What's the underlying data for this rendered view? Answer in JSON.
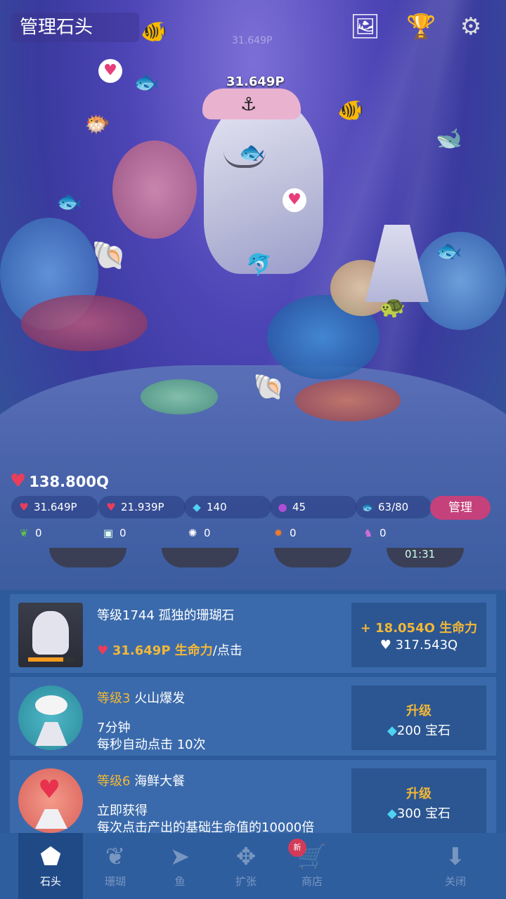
{
  "header": {
    "title": "管理石头",
    "tap_value_label": "31.649P",
    "ghost_value": "31.649P",
    "icons": [
      "photo-album-icon",
      "trophy-icon",
      "gear-icon"
    ]
  },
  "stats": {
    "total_life": "138.800Q",
    "per_tap": "31.649P",
    "per_second": "21.939P",
    "gems": "140",
    "pearls": "45",
    "fish_count": "63/80",
    "manage_label": "管理",
    "seaweed": "0",
    "ice": "0",
    "urchin": "0",
    "crab": "0",
    "seahorse": "0",
    "timer": "01:31"
  },
  "cards": [
    {
      "title_level": "等级1744",
      "title_name": "孤独的珊瑚石",
      "desc_value": "31.649P 生命力",
      "desc_suffix": "/点击",
      "btn_line1": "+ 18.054O 生命力",
      "btn_line2": "317.543Q",
      "progress": 0.75
    },
    {
      "title_level": "等级3",
      "title_name": "火山爆发",
      "line1": "7分钟",
      "line2": "每秒自动点击 10次",
      "btn_line1": "升级",
      "btn_line2": "200 宝石"
    },
    {
      "title_level": "等级6",
      "title_name": "海鲜大餐",
      "line1": "立即获得",
      "line2": "每次点击产出的基础生命值的10000倍",
      "btn_line1": "升级",
      "btn_line2": "300 宝石"
    }
  ],
  "nav": {
    "items": [
      {
        "label": "石头",
        "icon": "rock-icon",
        "active": true
      },
      {
        "label": "珊瑚",
        "icon": "coral-icon"
      },
      {
        "label": "鱼",
        "icon": "fish-icon"
      },
      {
        "label": "扩张",
        "icon": "expand-icon"
      },
      {
        "label": "商店",
        "icon": "cart-icon"
      },
      {
        "label": "关闭",
        "icon": "download-icon"
      }
    ],
    "new_badge": "新"
  },
  "colors": {
    "accent_gold": "#f3b737",
    "manage_pink": "#c4417b",
    "heart_red": "#e83e5c"
  }
}
